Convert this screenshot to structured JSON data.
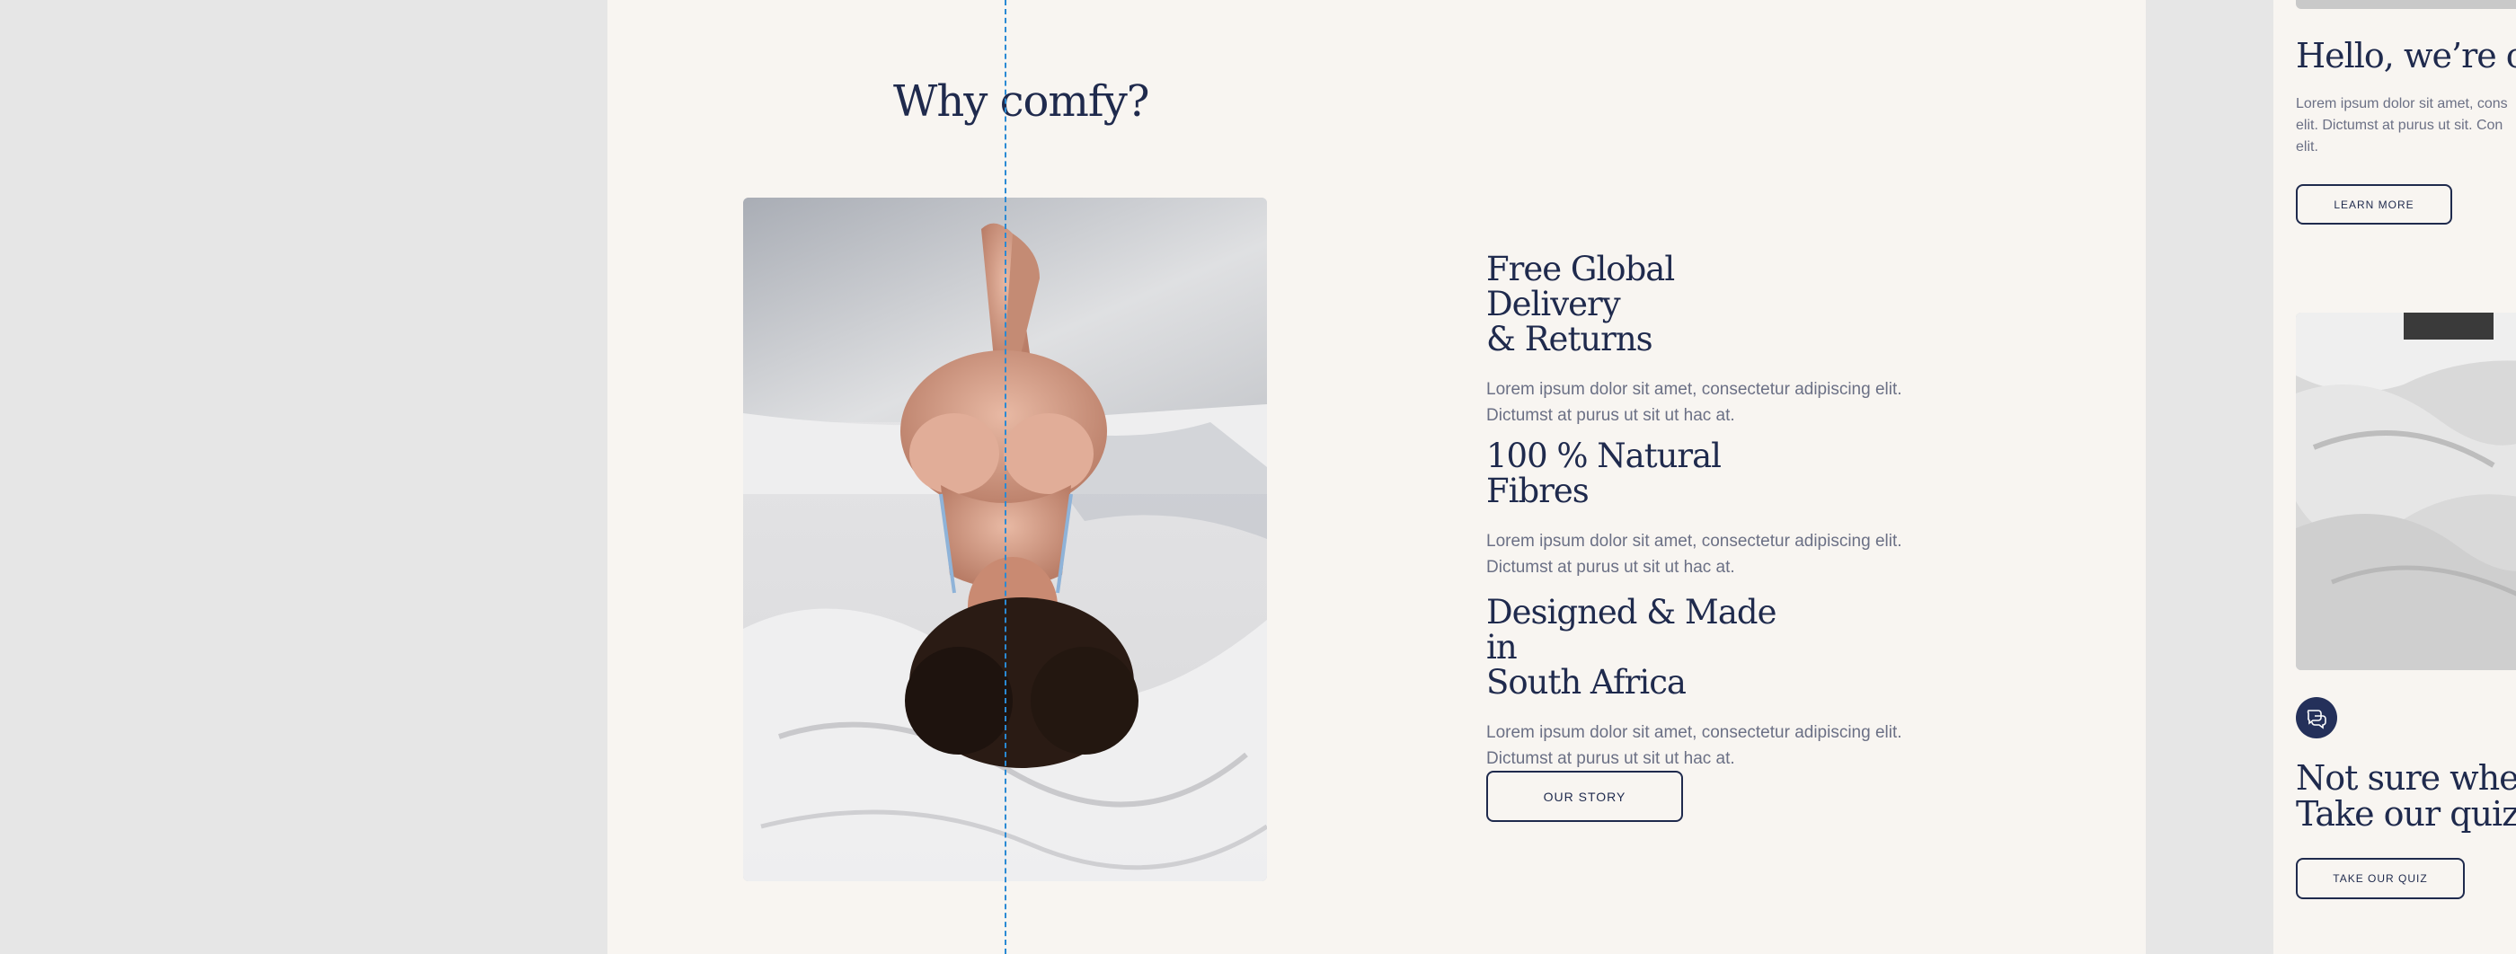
{
  "section": {
    "title": "Why comfy?",
    "features": [
      {
        "title_line1": "Free Global Delivery",
        "title_line2": "& Returns",
        "body_line1": "Lorem ipsum dolor sit amet, consectetur adipiscing elit.",
        "body_line2": "Dictumst at purus ut sit ut hac at."
      },
      {
        "title_line1": "100 % Natural Fibres",
        "title_line2": "",
        "body_line1": "Lorem ipsum dolor sit amet, consectetur adipiscing elit.",
        "body_line2": "Dictumst at purus ut sit ut hac at."
      },
      {
        "title_line1": "Designed & Made in",
        "title_line2": "South Africa",
        "body_line1": "Lorem ipsum dolor sit amet, consectetur adipiscing elit.",
        "body_line2": "Dictumst at purus ut sit ut hac at."
      }
    ],
    "cta_label": "OUR STORY"
  },
  "side_panel": {
    "hello_title": "Hello, we’re com",
    "hello_text_line1": "Lorem ipsum dolor sit amet, cons",
    "hello_text_line2": "elit. Dictumst at purus ut sit. Con",
    "hello_text_line3": "elit.",
    "learn_more_label": "LEARN MORE",
    "quiz_title_line1": "Not sure where t",
    "quiz_title_line2": "Take our quiz.",
    "quiz_button_label": "TAKE OUR QUIZ",
    "chat_icon": "chat-bubbles-icon"
  },
  "colors": {
    "navy": "#1f2a4d",
    "cream": "#f8f5f1",
    "canvas": "#e6e6e6",
    "guide": "#2a8ad4",
    "body_text": "#6b7085"
  }
}
